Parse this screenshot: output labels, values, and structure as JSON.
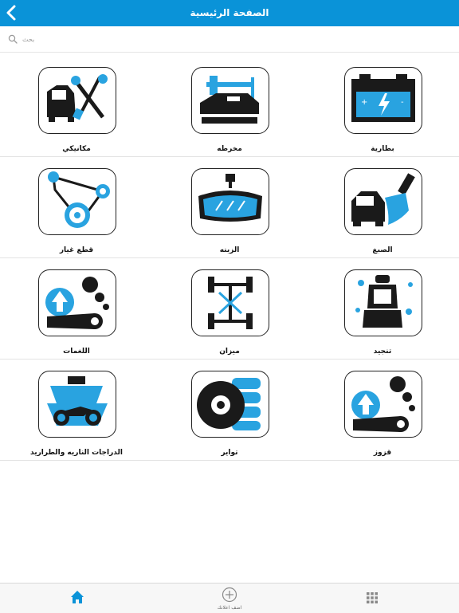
{
  "header": {
    "title": "الصفحة الرئيسية"
  },
  "search": {
    "placeholder": "بحث"
  },
  "grid": {
    "rows": [
      [
        {
          "label": "مكانيكي",
          "icon": "mechanic-icon"
        },
        {
          "label": "مخرطه",
          "icon": "lathe-icon"
        },
        {
          "label": "بطارية",
          "icon": "battery-icon"
        }
      ],
      [
        {
          "label": "قطع غيار",
          "icon": "spare-parts-icon"
        },
        {
          "label": "الزينه",
          "icon": "decoration-icon"
        },
        {
          "label": "الصبغ",
          "icon": "paint-icon"
        }
      ],
      [
        {
          "label": "اللغمات",
          "icon": "exhaust-icon"
        },
        {
          "label": "ميزان",
          "icon": "alignment-icon"
        },
        {
          "label": "تنجيد",
          "icon": "upholstery-icon"
        }
      ],
      [
        {
          "label": "الدراجات الناريه والطراريد",
          "icon": "motorcycle-jetski-icon"
        },
        {
          "label": "تواير",
          "icon": "tire-icon"
        },
        {
          "label": "قزوز",
          "icon": "glass-icon"
        }
      ]
    ]
  },
  "tabbar": {
    "home": "home-icon",
    "add_label": "اضف اعلانك",
    "menu": "grid-menu-icon"
  },
  "colors": {
    "accent": "#0a93d8",
    "dark": "#1a1a1a"
  }
}
